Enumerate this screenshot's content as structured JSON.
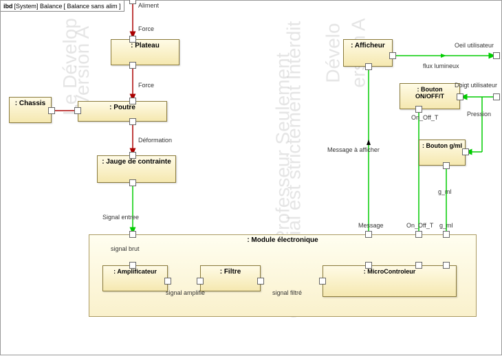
{
  "header": {
    "tag": "ibd",
    "context": "[System] Balance",
    "name": "[ Balance sans alim ]"
  },
  "blocks": {
    "chassis": ": Chassis",
    "plateau": ": Plateau",
    "poutre": ": Poutre",
    "jauge": ": Jauge de contrainte",
    "afficheur": ": Afficheur",
    "bouton_onoff": ": Bouton ON/OFF/T",
    "bouton_gml": ": Bouton g/ml",
    "module": ": Module électronique",
    "amplificateur": ": Amplificateur",
    "filtre": ": Filtre",
    "microcontroleur": ": MicroControleur"
  },
  "flows": {
    "aliment": "Aliment",
    "force1": "Force",
    "force2": "Force",
    "deformation": "Déformation",
    "signal_entree": "Signal entree",
    "signal_brut": "signal brut",
    "signal_amplifie": "signal amplifié",
    "signal_filtre": "signal filtré",
    "message_afficher": "Message à afficher",
    "message": "Message",
    "on_off_t_port": "On_Off_T",
    "on_off_t": "On_Off_T",
    "g_ml_port": "g_ml",
    "g_ml": "g_ml",
    "flux_lumineux": "flux lumineux",
    "oeil": "Oeil utilisateur",
    "doigt": "Doigt utilisateur",
    "pression": "Pression"
  },
  "watermarks": {
    "w1": "Version A",
    "w2": "Le Dévelop",
    "w3": "pour Professeur Seulement",
    "w4": "Commercial est strictement Interdit",
    "w5": "ersion A",
    "w6": "Dévelo"
  }
}
